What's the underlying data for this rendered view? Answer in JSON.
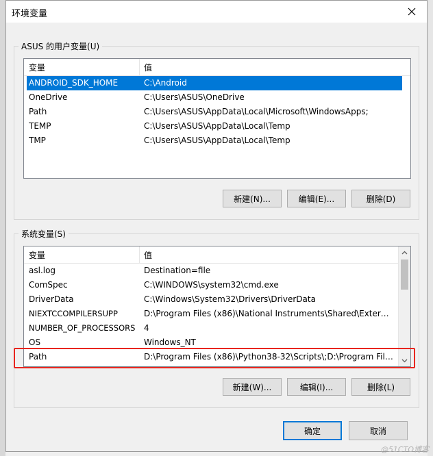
{
  "window": {
    "title": "环境变量"
  },
  "user_vars": {
    "group_label": "ASUS 的用户变量(U)",
    "col_variable": "变量",
    "col_value": "值",
    "rows": [
      {
        "name": "ANDROID_SDK_HOME",
        "value": "C:\\Android",
        "selected": true
      },
      {
        "name": "OneDrive",
        "value": "C:\\Users\\ASUS\\OneDrive"
      },
      {
        "name": "Path",
        "value": "C:\\Users\\ASUS\\AppData\\Local\\Microsoft\\WindowsApps;"
      },
      {
        "name": "TEMP",
        "value": "C:\\Users\\ASUS\\AppData\\Local\\Temp"
      },
      {
        "name": "TMP",
        "value": "C:\\Users\\ASUS\\AppData\\Local\\Temp"
      }
    ],
    "buttons": {
      "new": "新建(N)...",
      "edit": "编辑(E)...",
      "delete": "删除(D)"
    }
  },
  "system_vars": {
    "group_label": "系统变量(S)",
    "col_variable": "变量",
    "col_value": "值",
    "rows": [
      {
        "name": "asl.log",
        "value": "Destination=file"
      },
      {
        "name": "ComSpec",
        "value": "C:\\WINDOWS\\system32\\cmd.exe"
      },
      {
        "name": "DriverData",
        "value": "C:\\Windows\\System32\\Drivers\\DriverData"
      },
      {
        "name": "NIEXTCCOMPILERSUPP",
        "value": "D:\\Program Files (x86)\\National Instruments\\Shared\\External..."
      },
      {
        "name": "NUMBER_OF_PROCESSORS",
        "value": "4"
      },
      {
        "name": "OS",
        "value": "Windows_NT"
      },
      {
        "name": "Path",
        "value": "D:\\Program Files (x86)\\Python38-32\\Scripts\\;D:\\Program Files..."
      }
    ],
    "buttons": {
      "new": "新建(W)...",
      "edit": "编辑(I)...",
      "delete": "删除(L)"
    }
  },
  "footer": {
    "ok": "确定",
    "cancel": "取消"
  },
  "watermark": "@51CTO博客",
  "highlight_color": "#e8251e",
  "accent_color": "#0078d7"
}
